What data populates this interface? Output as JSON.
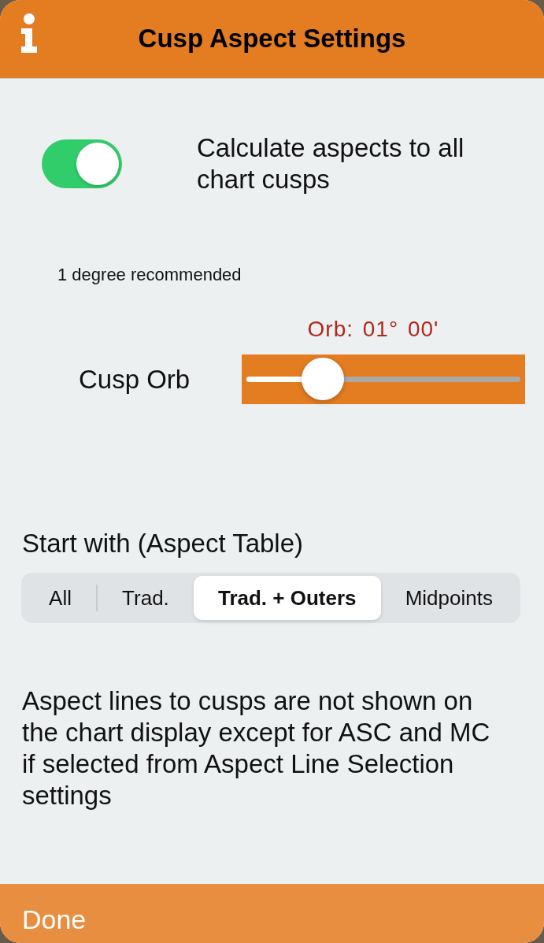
{
  "header": {
    "title": "Cusp Aspect Settings"
  },
  "toggle": {
    "label": "Calculate aspects to all chart cusps",
    "on": true
  },
  "hint": "1 degree recommended",
  "orb": {
    "reading": "Orb: 01° 00'",
    "label": "Cusp Orb",
    "level": 0.28
  },
  "start_with": {
    "label": "Start with (Aspect Table)",
    "segments": [
      {
        "label": "All",
        "selected": false
      },
      {
        "label": "Trad.",
        "selected": false
      },
      {
        "label": "Trad. + Outers",
        "selected": true
      },
      {
        "label": "Midpoints",
        "selected": false
      }
    ]
  },
  "note": "Aspect lines to cusps are not shown on the chart display except for ASC and MC if selected from Aspect Line Selection settings",
  "footer": {
    "button": "Done"
  }
}
